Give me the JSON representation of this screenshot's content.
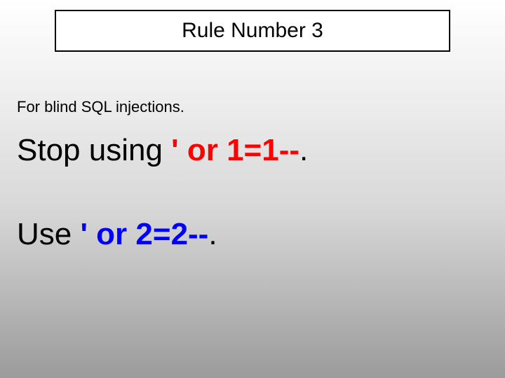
{
  "title": "Rule Number 3",
  "subtitle": "For blind SQL injections.",
  "line1": {
    "prefix": "Stop using ",
    "highlight": "' or 1=1--",
    "suffix": "."
  },
  "line2": {
    "prefix": "Use ",
    "highlight": "' or 2=2--",
    "suffix": "."
  },
  "colors": {
    "highlight1": "#ff0000",
    "highlight2": "#0000ff"
  }
}
